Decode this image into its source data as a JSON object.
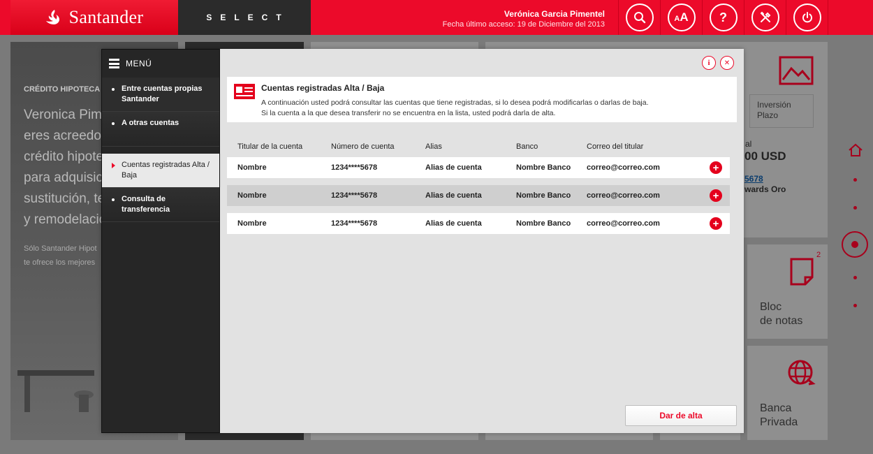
{
  "header": {
    "logo": "Santander",
    "product": "SELECT",
    "user_name": "Verónica Garcia Pimentel",
    "last_access": "Fecha último acceso: 19 de Diciembre del 2013",
    "buttons": [
      {
        "name": "search",
        "icon": "search-icon"
      },
      {
        "name": "font-size",
        "icon": "font-size-icon",
        "label": "AA"
      },
      {
        "name": "help",
        "icon": "help-icon",
        "label": "?"
      },
      {
        "name": "tools",
        "icon": "tools-icon"
      },
      {
        "name": "logout",
        "icon": "power-icon"
      }
    ],
    "colors": {
      "brand": "#ec0a2a",
      "dark": "#2b2b2b"
    }
  },
  "background": {
    "hero": {
      "category": "CRÉDITO HIPOTECA",
      "lines": [
        "Veronica Pime",
        "eres acreedor",
        "crédito hipotec",
        "para adquisici",
        "sustitución, te",
        "y remodelació"
      ],
      "small": [
        "Sólo Santander Hipot",
        "te ofrece los mejores"
      ]
    },
    "investment_box": "Inversión\nPlazo",
    "amount_fragment": "al",
    "amount": "00 USD",
    "link_fragment": "5678",
    "card_fragment": "wards Oro",
    "tiles": [
      {
        "label": "Bloc\nde notas",
        "icon": "notepad-icon",
        "badge": "2"
      },
      {
        "label": "Banca\nPrivada",
        "icon": "globe-icon"
      }
    ]
  },
  "menu": {
    "title": "MENÚ",
    "items": [
      {
        "label": "Entre cuentas propias Santander",
        "active": false
      },
      {
        "label": "A otras cuentas",
        "active": false
      },
      {
        "label": "Cuentas registradas Alta / Baja",
        "active": true
      },
      {
        "label": "Consulta de transferencia",
        "active": false
      }
    ]
  },
  "content": {
    "info_icon_label": "i",
    "close_icon_label": "✕",
    "info": {
      "title": "Cuentas registradas Alta / Baja",
      "line1": "A continuación usted podrá consultar las cuentas que tiene registradas, si lo desea podrá modificarlas o darlas de baja.",
      "line2": "Si la cuenta a la que desea transferir no se encuentra en la lista, usted podrá darla de alta."
    },
    "table": {
      "headers": [
        "Titular de la cuenta",
        "Número de cuenta",
        "Alias",
        "Banco",
        "Correo del titular"
      ],
      "rows": [
        [
          "Nombre",
          "1234****5678",
          "Alias de cuenta",
          "Nombre Banco",
          "correo@correo.com"
        ],
        [
          "Nombre",
          "1234****5678",
          "Alias de cuenta",
          "Nombre Banco",
          "correo@correo.com"
        ],
        [
          "Nombre",
          "1234****5678",
          "Alias de cuenta",
          "Nombre Banco",
          "correo@correo.com"
        ]
      ]
    },
    "add_button": "Dar de alta"
  }
}
